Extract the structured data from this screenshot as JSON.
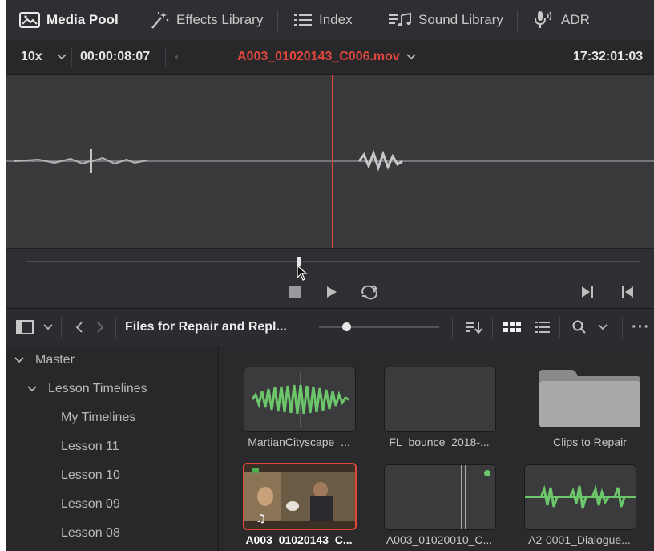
{
  "toolbar": {
    "tabs": [
      {
        "label": "Media Pool",
        "icon": "media-pool-icon",
        "active": true
      },
      {
        "label": "Effects Library",
        "icon": "effects-wand-icon",
        "active": false
      },
      {
        "label": "Index",
        "icon": "index-list-icon",
        "active": false
      },
      {
        "label": "Sound Library",
        "icon": "sound-library-icon",
        "active": false
      },
      {
        "label": "ADR",
        "icon": "microphone-icon",
        "active": false
      }
    ]
  },
  "viewer": {
    "zoom": "10x",
    "duration": "00:00:08:07",
    "clip_name": "A003_01020143_C006.mov",
    "timecode": "17:32:01:03",
    "accent_color": "#e0473c",
    "waveform_color": "#b8b8b8"
  },
  "pool": {
    "bin_title": "Files for Repair and Repl...",
    "tree": [
      {
        "label": "Master",
        "expanded": true
      },
      {
        "label": "Lesson Timelines",
        "expanded": true
      },
      {
        "label": "My Timelines"
      },
      {
        "label": "Lesson 11"
      },
      {
        "label": "Lesson 10"
      },
      {
        "label": "Lesson 09"
      },
      {
        "label": "Lesson 08"
      }
    ],
    "clips": [
      {
        "caption": "MartianCityscape_...",
        "kind": "audio"
      },
      {
        "caption": "FL_bounce_2018-...",
        "kind": "empty"
      },
      {
        "caption": "Clips to Repair",
        "kind": "folder"
      },
      {
        "caption": "A003_01020143_C...",
        "kind": "video",
        "selected": true
      },
      {
        "caption": "A003_01020010_C...",
        "kind": "empty-dot"
      },
      {
        "caption": "A2-0001_Dialogue...",
        "kind": "audio"
      }
    ],
    "audio_color": "#6cc76a"
  }
}
